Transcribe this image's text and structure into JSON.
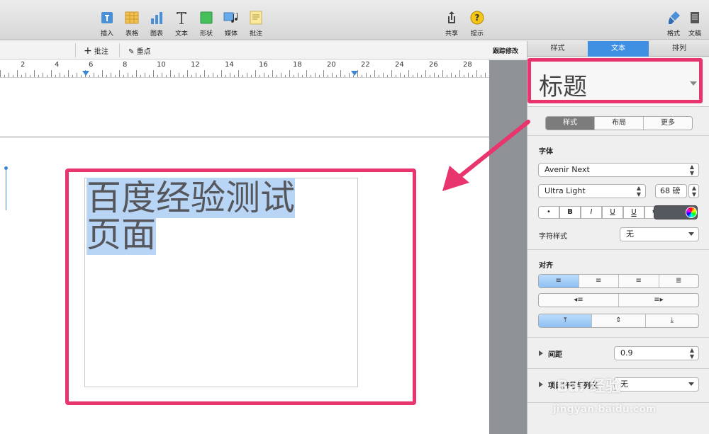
{
  "toolbar": {
    "insert": "插入",
    "table": "表格",
    "chart": "图表",
    "text": "文本",
    "shape": "形状",
    "media": "媒体",
    "comment": "批注",
    "share": "共享",
    "tips": "提示",
    "format": "格式",
    "document": "文稿"
  },
  "subbar": {
    "add_comment": "批注",
    "highlight": "重点",
    "track_changes": "跟踪修改"
  },
  "ruler": {
    "numbers": [
      "2",
      "4",
      "6",
      "8",
      "10",
      "12",
      "14",
      "16",
      "18",
      "20",
      "22",
      "24",
      "26",
      "28"
    ]
  },
  "document": {
    "line1": "百度经验测试",
    "line2": "页面"
  },
  "inspector": {
    "tabs": [
      "样式",
      "文本",
      "排列"
    ],
    "active_tab": "文本",
    "paragraph_style": "标题",
    "subtabs": [
      "样式",
      "布局",
      "更多"
    ],
    "font_section": "字体",
    "font_family": "Avenir Next",
    "font_typeface": "Ultra Light",
    "font_size": "68 磅",
    "format_buttons": [
      "•",
      "B",
      "I",
      "U",
      "U",
      "⚙"
    ],
    "char_style_label": "字符样式",
    "char_style_value": "无",
    "align_section": "对齐",
    "spacing_label": "间距",
    "spacing_value": "0.9",
    "bullets_label": "项目符号与列表",
    "bullets_value": "无"
  },
  "watermark": {
    "brand": "Bai 经验",
    "url": "jingyan.baidu.com"
  },
  "colors": {
    "accent": "#3f8fe3",
    "highlight_frame": "#e8356e",
    "selection": "#b9d5f5",
    "text_color_swatch": "#55595f"
  }
}
